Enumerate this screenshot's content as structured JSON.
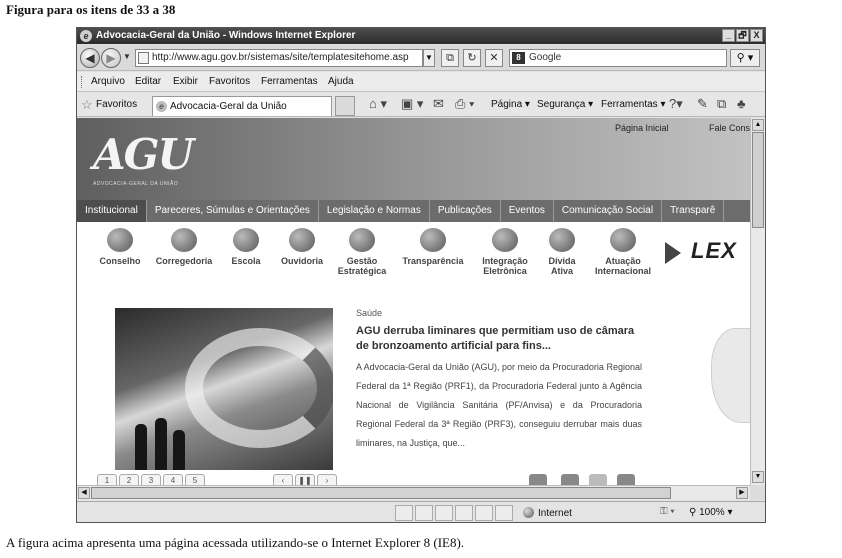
{
  "document": {
    "heading": "Figura para os itens de 33 a 38",
    "caption": "A figura acima apresenta uma página acessada utilizando-se o Internet Explorer 8 (IE8)."
  },
  "browser": {
    "title": "Advocacia-Geral da União - Windows Internet Explorer",
    "window_buttons": [
      "_",
      "🗗",
      "X"
    ],
    "url": "http://www.agu.gov.br/sistemas/site/templatesitehome.asp",
    "search_placeholder": "Google",
    "menu": [
      "Arquivo",
      "Editar",
      "Exibir",
      "Favoritos",
      "Ferramentas",
      "Ajuda"
    ],
    "favorites_label": "Favoritos",
    "tab_label": "Advocacia-Geral da União",
    "commands": [
      "Página ▾",
      "Segurança ▾",
      "Ferramentas ▾"
    ],
    "status": {
      "zone": "Internet",
      "zoom": "100%"
    }
  },
  "site": {
    "top_links": {
      "home": "Página Inicial",
      "contact": "Fale Cons"
    },
    "logo_text": "AGU",
    "logo_subtitle": "ADVOCACIA-GERAL DA UNIÃO",
    "nav": [
      "Institucional",
      "Pareceres, Súmulas e Orientações",
      "Legislação e Normas",
      "Publicações",
      "Eventos",
      "Comunicação Social",
      "Transparê"
    ],
    "services": [
      {
        "label": "Conselho",
        "icon": "people-icon"
      },
      {
        "label": "Corregedoria",
        "icon": "checklist-icon"
      },
      {
        "label": "Escola",
        "icon": "school-icon"
      },
      {
        "label": "Ouvidoria",
        "icon": "speech-icon"
      },
      {
        "label": "Gestão Estratégica",
        "icon": "target-icon"
      },
      {
        "label": "Transparência",
        "icon": "blocks-icon"
      },
      {
        "label": "Integração Eletrônica",
        "icon": "network-icon"
      },
      {
        "label": "Dívida Ativa",
        "icon": "cubes-icon"
      },
      {
        "label": "Atuação Internacional",
        "icon": "globe-icon"
      }
    ],
    "lex_text": "LEX",
    "news": {
      "section": "Saúde",
      "title": "AGU derruba liminares que permitiam uso de câmara de bronzoamento artificial para fins...",
      "body": "A Advocacia-Geral da União (AGU), por meio da Procuradoria Regional Federal da 1ª Região (PRF1), da Procuradoria Federal junto à Agência Nacional de Vigilância Sanitária (PF/Anvisa) e da Procuradoria Regional Federal da 3ª Região (PRF3), conseguiu derrubar mais duas liminares, na Justiça, que..."
    },
    "pager": [
      "1",
      "2",
      "3",
      "4",
      "5"
    ],
    "pager_controls": [
      "‹",
      "❚❚",
      "›"
    ]
  }
}
